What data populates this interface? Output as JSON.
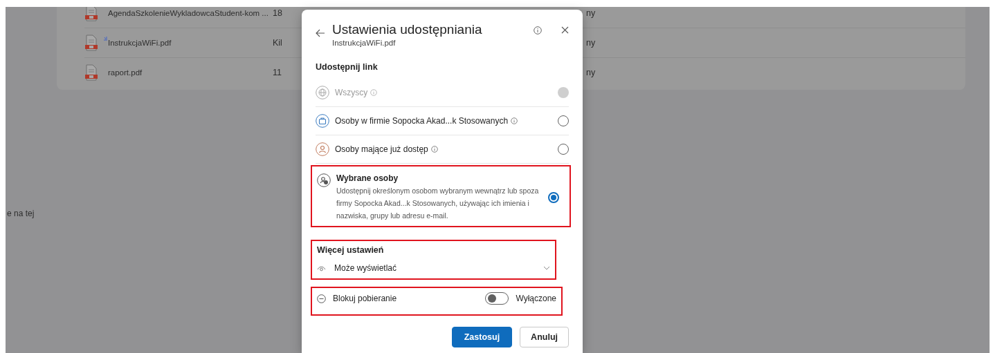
{
  "files": [
    {
      "name": "AgendaSzkolenieWykladowcaStudent-kom ...",
      "column_2": "18",
      "column_3": "ny",
      "new": false
    },
    {
      "name": "InstrukcjaWiFi.pdf",
      "column_2": "Kil",
      "column_3": "ny",
      "new": true
    },
    {
      "name": "raport.pdf",
      "column_2": "11",
      "column_3": "ny",
      "new": false
    }
  ],
  "side_text": "e na tej",
  "dialog": {
    "title": "Ustawienia udostępniania",
    "subtitle": "InstrukcjaWiFi.pdf",
    "section_title": "Udostępnij link",
    "options": [
      {
        "kind": "globe",
        "label": "Wszyscy",
        "info": true,
        "disabled": true,
        "selected": false,
        "highlighted": false
      },
      {
        "kind": "briefcase",
        "label": "Osoby w firmie Sopocka Akad...k Stosowanych",
        "info": true,
        "disabled": false,
        "selected": false,
        "highlighted": false
      },
      {
        "kind": "person",
        "label": "Osoby mające już dostęp",
        "info": true,
        "disabled": false,
        "selected": false,
        "highlighted": false
      },
      {
        "kind": "people",
        "label": "Wybrane osoby",
        "description": "Udostępnij określonym osobom wybranym wewnątrz lub spoza firmy Sopocka Akad...k Stosowanych, używając ich imienia i nazwiska, grupy lub adresu e-mail.",
        "info": false,
        "disabled": false,
        "selected": true,
        "highlighted": true
      }
    ],
    "more_settings": {
      "title": "Więcej ustawień",
      "permission": "Może wyświetlać",
      "highlighted": true
    },
    "block_download": {
      "label": "Blokuj pobieranie",
      "on": false,
      "state_text": "Wyłączone",
      "highlighted": true
    },
    "buttons": [
      {
        "label": "Zastosuj",
        "kind": "primary"
      },
      {
        "label": "Anuluj",
        "kind": "secondary"
      }
    ]
  }
}
